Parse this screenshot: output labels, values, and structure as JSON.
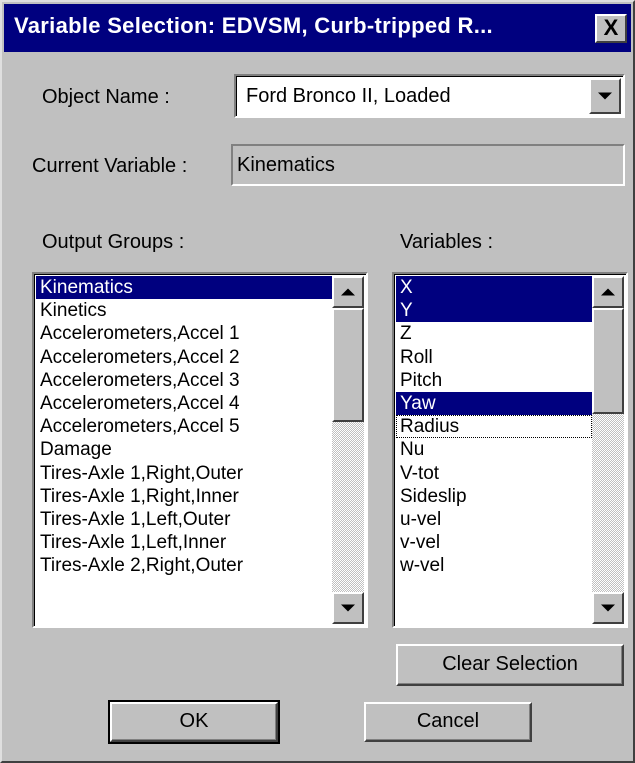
{
  "window": {
    "title": "Variable Selection: EDVSM, Curb-tripped R...",
    "close_label": "X"
  },
  "object_name": {
    "label": "Object Name :",
    "value": "Ford  Bronco II, Loaded"
  },
  "current_variable": {
    "label": "Current Variable :",
    "value": "Kinematics"
  },
  "output_groups": {
    "label": "Output Groups :",
    "items": [
      {
        "label": "Kinematics",
        "selected": true
      },
      {
        "label": "Kinetics",
        "selected": false
      },
      {
        "label": "Accelerometers,Accel 1",
        "selected": false
      },
      {
        "label": "Accelerometers,Accel 2",
        "selected": false
      },
      {
        "label": "Accelerometers,Accel 3",
        "selected": false
      },
      {
        "label": "Accelerometers,Accel 4",
        "selected": false
      },
      {
        "label": "Accelerometers,Accel 5",
        "selected": false
      },
      {
        "label": "Damage",
        "selected": false
      },
      {
        "label": "Tires-Axle 1,Right,Outer",
        "selected": false
      },
      {
        "label": "Tires-Axle 1,Right,Inner",
        "selected": false
      },
      {
        "label": "Tires-Axle 1,Left,Outer",
        "selected": false
      },
      {
        "label": "Tires-Axle 1,Left,Inner",
        "selected": false
      },
      {
        "label": "Tires-Axle 2,Right,Outer",
        "selected": false
      }
    ]
  },
  "variables": {
    "label": "Variables :",
    "items": [
      {
        "label": "X",
        "selected": true,
        "focused": false
      },
      {
        "label": "Y",
        "selected": true,
        "focused": false
      },
      {
        "label": "Z",
        "selected": false,
        "focused": false
      },
      {
        "label": "Roll",
        "selected": false,
        "focused": false
      },
      {
        "label": "Pitch",
        "selected": false,
        "focused": false
      },
      {
        "label": "Yaw",
        "selected": true,
        "focused": false
      },
      {
        "label": "Radius",
        "selected": false,
        "focused": true
      },
      {
        "label": "Nu",
        "selected": false,
        "focused": false
      },
      {
        "label": "V-tot",
        "selected": false,
        "focused": false
      },
      {
        "label": "Sideslip",
        "selected": false,
        "focused": false
      },
      {
        "label": "u-vel",
        "selected": false,
        "focused": false
      },
      {
        "label": "v-vel",
        "selected": false,
        "focused": false
      },
      {
        "label": "w-vel",
        "selected": false,
        "focused": false
      }
    ]
  },
  "buttons": {
    "clear_selection": "Clear Selection",
    "ok": "OK",
    "cancel": "Cancel"
  },
  "colors": {
    "face": "#c0c0c0",
    "titlebar": "#00007f",
    "selection": "#00007f"
  }
}
